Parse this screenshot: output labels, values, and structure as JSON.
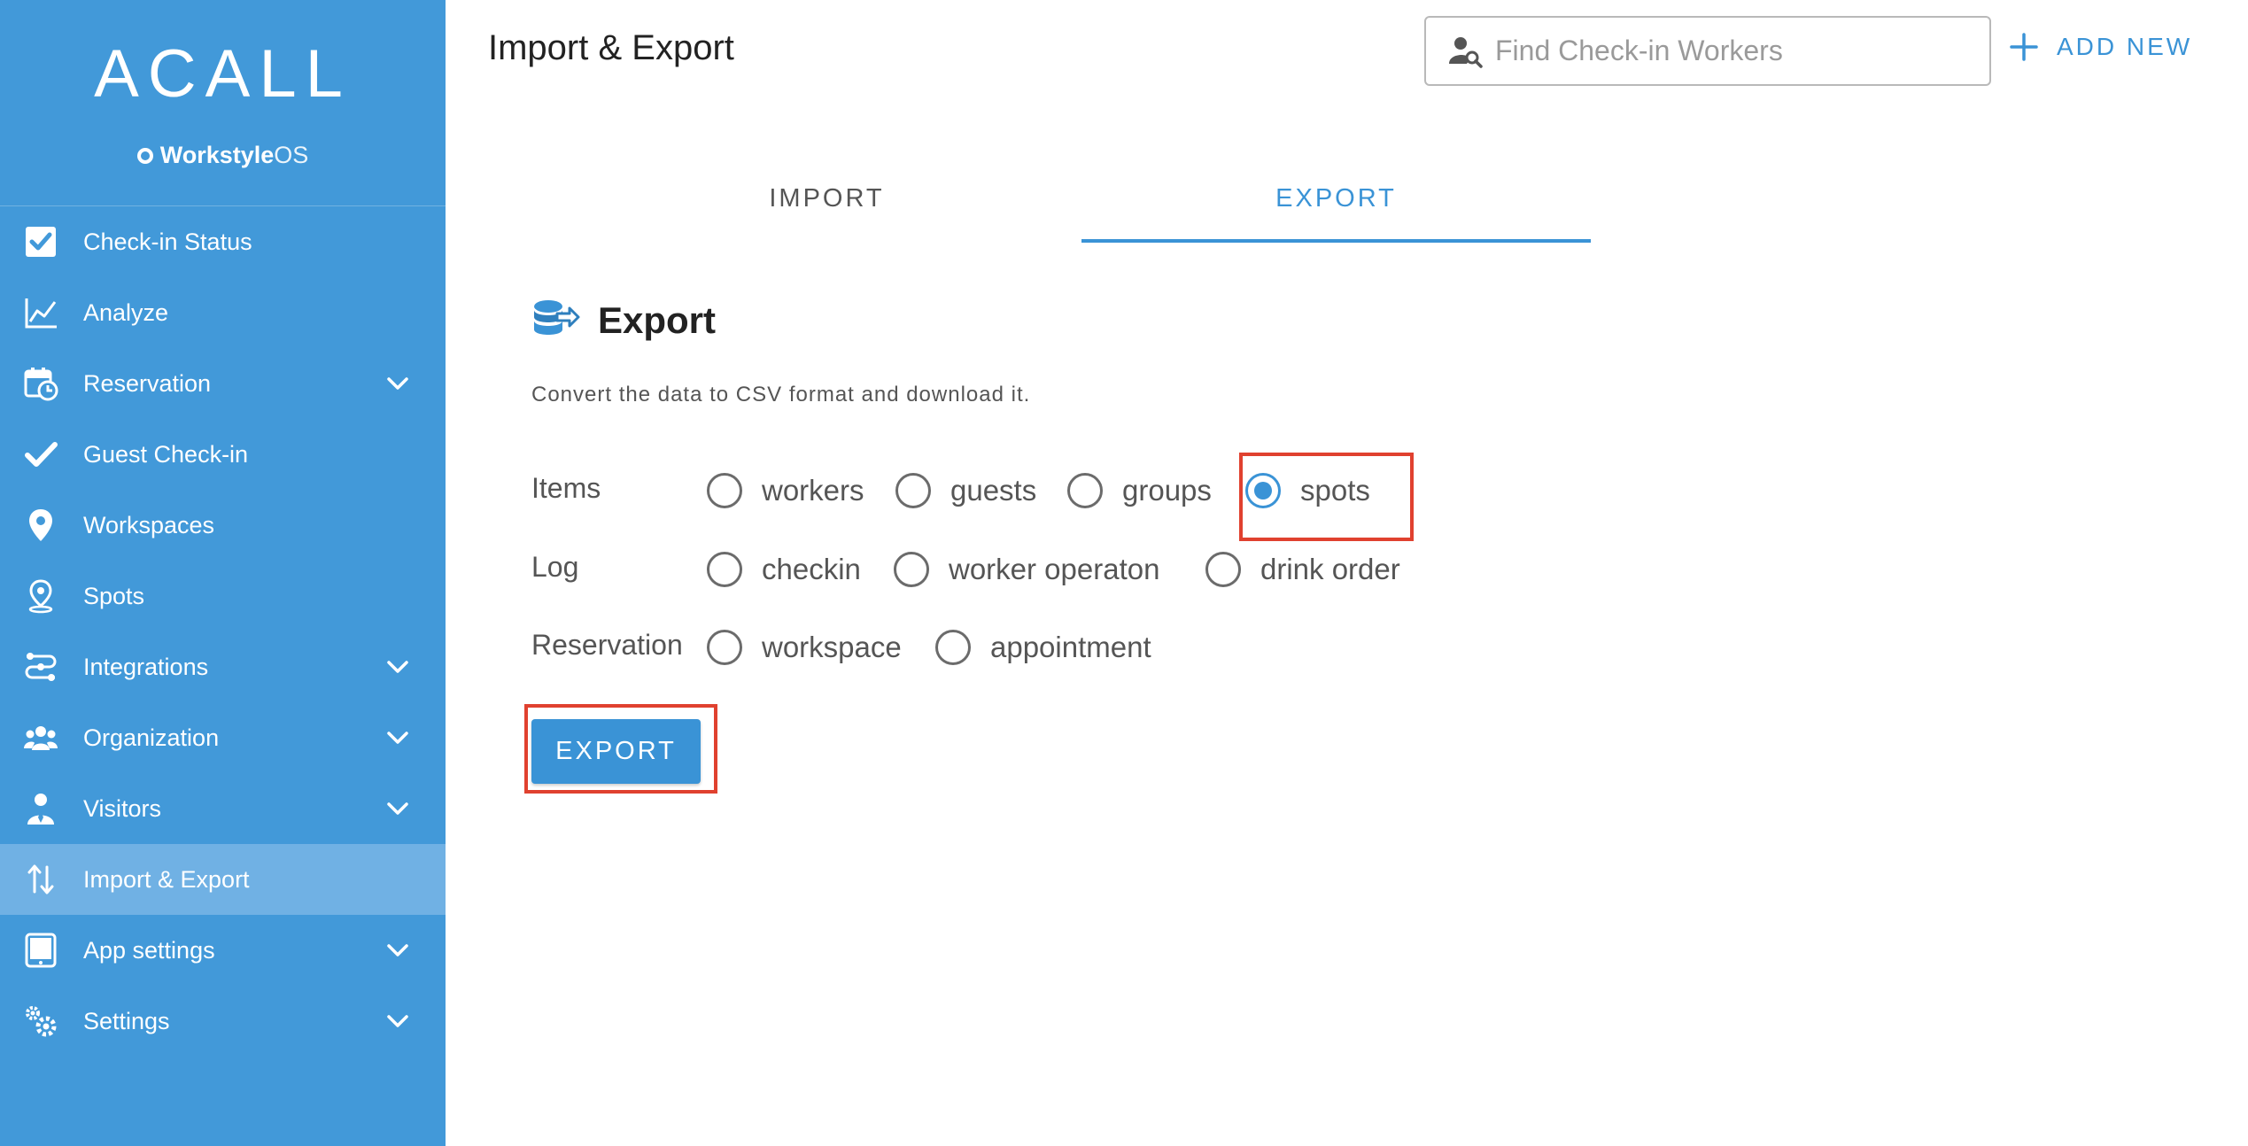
{
  "sidebar": {
    "logo": "ACALL",
    "subbrand_bold": "Workstyle",
    "subbrand_light": "OS",
    "items": [
      {
        "label": "Check-in Status",
        "icon": "checkbox-icon",
        "chevron": false
      },
      {
        "label": "Analyze",
        "icon": "line-chart-icon",
        "chevron": false
      },
      {
        "label": "Reservation",
        "icon": "calendar-clock-icon",
        "chevron": true
      },
      {
        "label": "Guest Check-in",
        "icon": "checkmark-icon",
        "chevron": false
      },
      {
        "label": "Workspaces",
        "icon": "map-pin-icon",
        "chevron": false
      },
      {
        "label": "Spots",
        "icon": "location-pin-icon",
        "chevron": false
      },
      {
        "label": "Integrations",
        "icon": "integrations-icon",
        "chevron": true
      },
      {
        "label": "Organization",
        "icon": "people-icon",
        "chevron": true
      },
      {
        "label": "Visitors",
        "icon": "visitor-icon",
        "chevron": true
      },
      {
        "label": "Import & Export",
        "icon": "arrows-up-down-icon",
        "chevron": false,
        "active": true
      },
      {
        "label": "App settings",
        "icon": "tablet-icon",
        "chevron": true
      },
      {
        "label": "Settings",
        "icon": "gears-icon",
        "chevron": true
      }
    ]
  },
  "header": {
    "title": "Import & Export",
    "search_placeholder": "Find Check-in Workers",
    "add_new_label": "ADD NEW"
  },
  "tabs": [
    {
      "label": "IMPORT",
      "active": false
    },
    {
      "label": "EXPORT",
      "active": true
    }
  ],
  "export_section": {
    "title": "Export",
    "description": "Convert the data to CSV format and download it.",
    "rows": [
      {
        "label": "Items",
        "options": [
          "workers",
          "guests",
          "groups",
          "spots"
        ]
      },
      {
        "label": "Log",
        "options": [
          "checkin",
          "worker operaton",
          "drink order"
        ]
      },
      {
        "label": "Reservation",
        "options": [
          "workspace",
          "appointment"
        ]
      }
    ],
    "selected": "spots",
    "button_label": "EXPORT"
  },
  "colors": {
    "sidebar_bg": "#4299d9",
    "sidebar_active": "#70b1e4",
    "accent": "#3a93d6",
    "highlight": "#e0412f"
  }
}
